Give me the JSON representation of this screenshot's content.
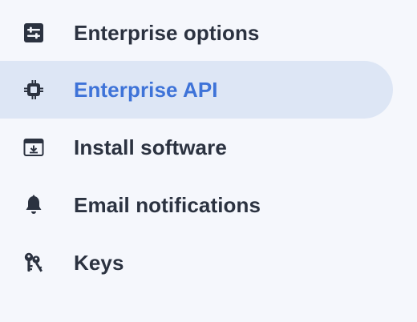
{
  "sidebar": {
    "items": [
      {
        "label": "Enterprise options",
        "icon": "sliders-icon",
        "active": false
      },
      {
        "label": "Enterprise API",
        "icon": "chip-icon",
        "active": true
      },
      {
        "label": "Install software",
        "icon": "download-window-icon",
        "active": false
      },
      {
        "label": "Email notifications",
        "icon": "bell-icon",
        "active": false
      },
      {
        "label": "Keys",
        "icon": "keys-icon",
        "active": false
      }
    ]
  },
  "colors": {
    "background": "#f5f7fc",
    "active_background": "#dde6f5",
    "active_text": "#3e73d8",
    "text": "#2b3240",
    "icon": "#2b3240"
  }
}
